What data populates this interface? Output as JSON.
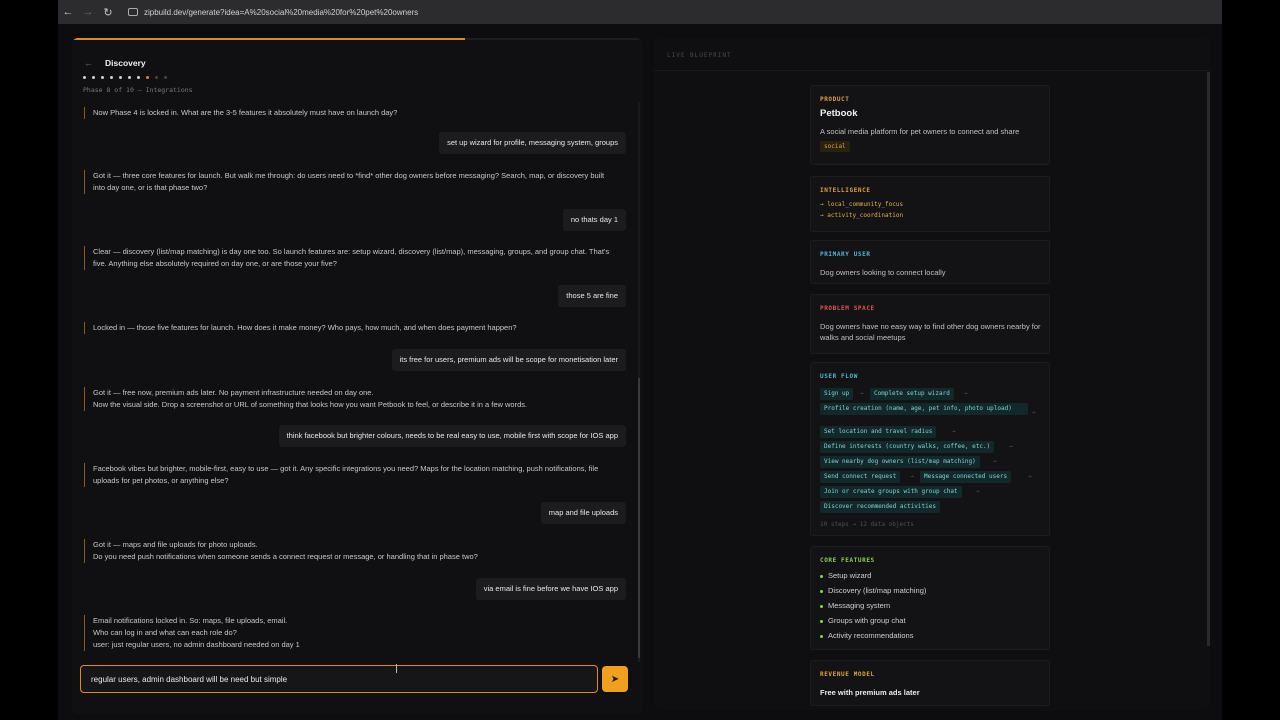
{
  "browser": {
    "url": "zipbuild.dev/generate?idea=A%20social%20media%20for%20pet%20owners"
  },
  "colors": {
    "accent": "#f0a01e",
    "ai_border": "#8a5a18",
    "flow": "#7fd6d0",
    "feature_bullet": "#8fd14f"
  },
  "chat": {
    "title": "Discovery",
    "phase_label": "Phase 8 of 10 — Integrations",
    "progress": 0.69,
    "input_value": "regular users, admin dashboard will be need but simple",
    "messages": [
      {
        "role": "ai",
        "text": "Now Phase 4 is locked in. What are the 3-5 features it absolutely must have on launch day?"
      },
      {
        "role": "user",
        "text": "set up wizard for profile, messaging system, groups"
      },
      {
        "role": "ai",
        "text": "Got it — three core features for launch. But walk me through: do users need to *find* other dog owners before messaging? Search, map, or discovery built into day one, or is that phase two?"
      },
      {
        "role": "user",
        "text": "no thats day 1"
      },
      {
        "role": "ai",
        "text": "Clear — discovery (list/map matching) is day one too. So launch features are: setup wizard, discovery (list/map), messaging, groups, and group chat. That's five. Anything else absolutely required on day one, or are those your five?"
      },
      {
        "role": "user",
        "text": "those 5 are fine"
      },
      {
        "role": "ai",
        "text": "Locked in — those five features for launch. How does it make money? Who pays, how much, and when does payment happen?"
      },
      {
        "role": "user",
        "text": "its free for users, premium ads will be scope for monetisation later"
      },
      {
        "role": "ai",
        "text": "Got it — free now, premium ads later. No payment infrastructure needed on day one.\nNow the visual side. Drop a screenshot or URL of something that looks how you want Petbook to feel, or describe it in a few words."
      },
      {
        "role": "user",
        "text": "think facebook but brighter colours, needs to be real easy to use, mobile first with scope for IOS app"
      },
      {
        "role": "ai",
        "text": "Facebook vibes but brighter, mobile-first, easy to use — got it. Any specific integrations you need? Maps for the location matching, push notifications, file uploads for pet photos, or anything else?"
      },
      {
        "role": "user",
        "text": "map and file uploads"
      },
      {
        "role": "ai",
        "text": "Got it — maps and file uploads for photo uploads.\nDo you need push notifications when someone sends a connect request or message, or handling that in phase two?"
      },
      {
        "role": "user",
        "text": "via email is fine before we have IOS app"
      },
      {
        "role": "ai",
        "text": "Email notifications locked in. So: maps, file uploads, email.\nWho can log in and what can each role do?\nuser: just regular users, no admin dashboard needed on day 1"
      }
    ]
  },
  "blueprint": {
    "label": "LIVE BLUEPRINT",
    "product": {
      "label": "PRODUCT",
      "name": "Petbook",
      "description": "A social media platform for pet owners to connect and share",
      "tag": "social"
    },
    "intelligence": {
      "label": "INTELLIGENCE",
      "items": [
        "→ local_community_focus",
        "→ activity_coordination"
      ]
    },
    "primary_user": {
      "label": "PRIMARY USER",
      "text": "Dog owners looking to connect locally"
    },
    "problem_space": {
      "label": "PROBLEM SPACE",
      "text": "Dog owners have no easy way to find other dog owners nearby for walks and social meetups"
    },
    "user_flow": {
      "label": "USER FLOW",
      "steps": [
        "Sign up",
        "Complete setup wizard",
        "Profile creation (name, age, pet info, photo upload)",
        "Set location and travel radius",
        "Define interests (country walks, coffee, etc.)",
        "View nearby dog owners (list/map matching)",
        "Send connect request",
        "Message connected users",
        "Join or create groups with group chat",
        "Discover recommended activities"
      ],
      "meta": "10 steps → 12 data objects"
    },
    "core_features": {
      "label": "CORE FEATURES",
      "items": [
        "Setup wizard",
        "Discovery (list/map matching)",
        "Messaging system",
        "Groups with group chat",
        "Activity recommendations"
      ]
    },
    "revenue_model": {
      "label": "REVENUE MODEL",
      "text": "Free with premium ads later"
    }
  }
}
